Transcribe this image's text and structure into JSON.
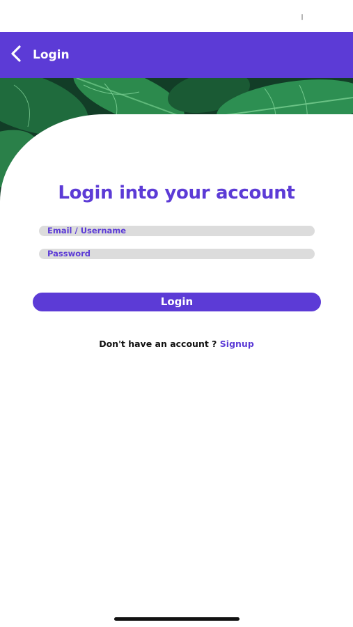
{
  "app_bar": {
    "title": "Login",
    "back_icon": "chevron-left-icon",
    "color": "#5c3bd6"
  },
  "banner": {
    "image": "green leaves"
  },
  "form": {
    "heading": "Login into your account",
    "email_placeholder": "Email / Username",
    "password_placeholder": "Password",
    "login_label": "Login"
  },
  "signup": {
    "prompt": "Don't have an account ? ",
    "link_label": "Signup"
  },
  "colors": {
    "accent": "#5c3bd6",
    "field_background": "#dcdcdc",
    "text": "#111111"
  }
}
